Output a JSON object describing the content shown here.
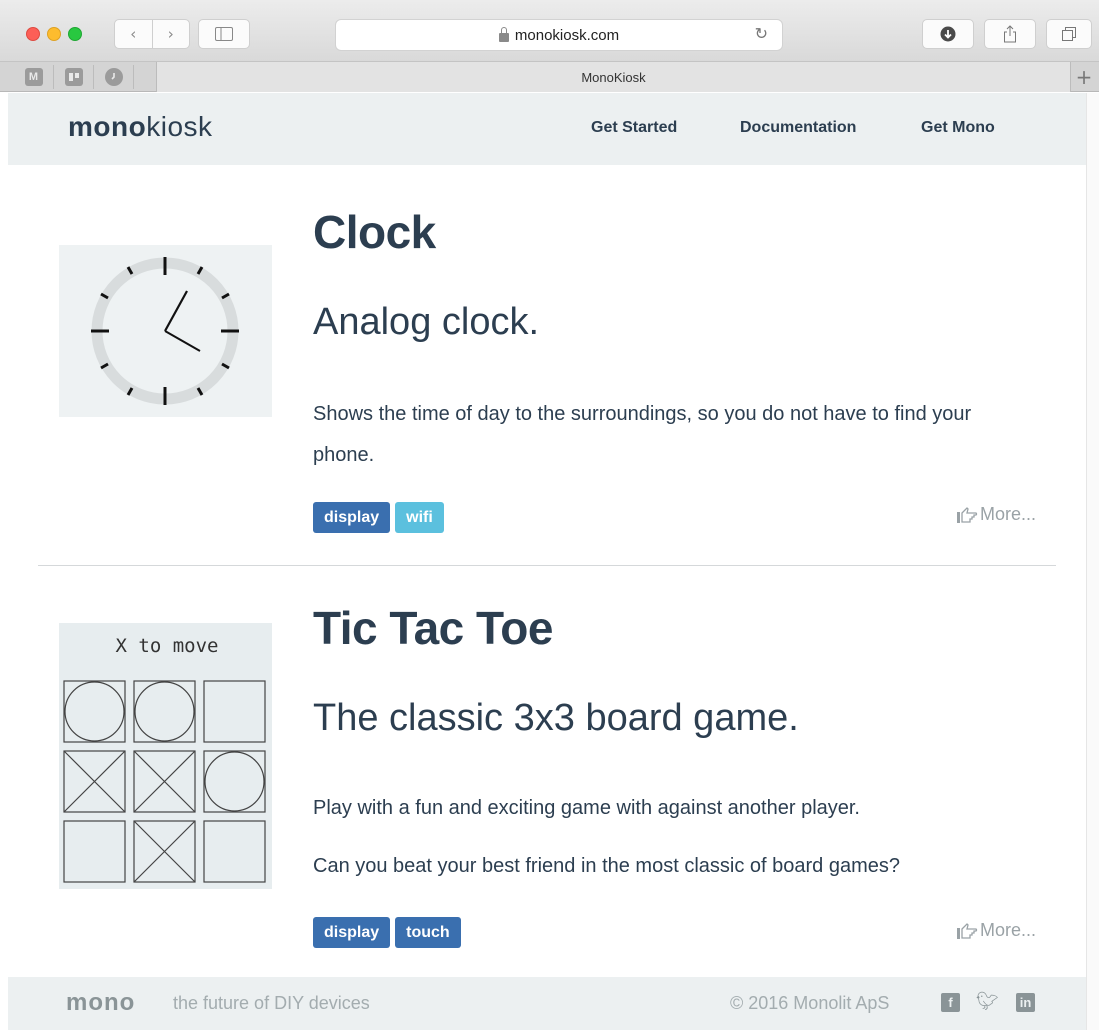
{
  "browser": {
    "url": "monokiosk.com",
    "tab_title": "MonoKiosk",
    "pinned_tabs": [
      {
        "label": "M",
        "icon": "gmail-icon"
      },
      {
        "label": "",
        "icon": "trello-icon"
      },
      {
        "label": "",
        "icon": "clock-app-icon"
      }
    ],
    "new_tab_symbol": "+",
    "colors": {
      "close": "#fc5f57",
      "minimize": "#fdbc2e",
      "maximize": "#28c840"
    }
  },
  "site": {
    "logo_bold": "mono",
    "logo_light": "kiosk",
    "nav": [
      "Get Started",
      "Documentation",
      "Get Mono"
    ],
    "brand_color": "#2c3e50"
  },
  "apps": [
    {
      "title": "Clock",
      "subtitle": "Analog clock.",
      "description": [
        "Shows the time of day to the surroundings, so you do not have to find your phone."
      ],
      "tags": [
        {
          "label": "display",
          "color": "#3a6faf"
        },
        {
          "label": "wifi",
          "color": "#5bc0de"
        }
      ],
      "more_label": "More..."
    },
    {
      "title": "Tic Tac Toe",
      "subtitle": "The classic 3x3 board game.",
      "description": [
        "Play with a fun and exciting game with against another player.",
        "Can you beat your best friend in the most classic of board games?"
      ],
      "tags": [
        {
          "label": "display",
          "color": "#3a6faf"
        },
        {
          "label": "touch",
          "color": "#3a6faf"
        }
      ],
      "more_label": "More...",
      "preview": {
        "status_text": "X to move",
        "board": [
          "O",
          "O",
          "",
          "X",
          "X",
          "O",
          "",
          "X",
          ""
        ]
      }
    }
  ],
  "footer": {
    "logo": "mono",
    "tagline": "the future of DIY devices",
    "copyright": "© 2016 Monolit ApS",
    "social": [
      "facebook-icon",
      "twitter-icon",
      "linkedin-icon"
    ]
  }
}
